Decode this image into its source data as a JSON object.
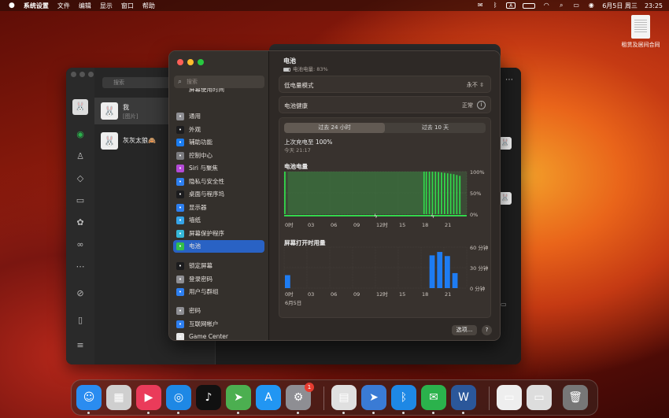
{
  "menubar": {
    "app_name": "系统设置",
    "menus": [
      "文件",
      "编辑",
      "显示",
      "窗口",
      "帮助"
    ],
    "input_indicator": "A",
    "date": "6月5日 周三",
    "time": "23:25"
  },
  "desktop": {
    "file_label": "租赁及居间合同"
  },
  "wechat": {
    "search_placeholder": "搜索",
    "chats": [
      {
        "name": "我",
        "preview": "[图片]"
      },
      {
        "name": "灰灰太狼🙈",
        "preview": ""
      }
    ]
  },
  "settings": {
    "search_placeholder": "搜索",
    "top_partial": "屏幕使用时间",
    "group1": [
      {
        "label": "通用",
        "icon": "gear-icon",
        "color": "#8e8e93"
      },
      {
        "label": "外观",
        "icon": "appearance-icon",
        "color": "#1c1c1e"
      },
      {
        "label": "辅助功能",
        "icon": "accessibility-icon",
        "color": "#1a7cf0"
      },
      {
        "label": "控制中心",
        "icon": "control-center-icon",
        "color": "#7c7c80"
      },
      {
        "label": "Siri 与聚焦",
        "icon": "siri-icon",
        "color": "#b44ad6"
      },
      {
        "label": "隐私与安全性",
        "icon": "hand-icon",
        "color": "#2d7ff0"
      }
    ],
    "group2": [
      {
        "label": "桌面与程序坞",
        "icon": "dock-icon",
        "color": "#1c1c1e"
      },
      {
        "label": "显示器",
        "icon": "display-icon",
        "color": "#2d7ff0"
      },
      {
        "label": "墙纸",
        "icon": "wallpaper-icon",
        "color": "#35a4e8"
      },
      {
        "label": "屏幕保护程序",
        "icon": "screensaver-icon",
        "color": "#35b8d8"
      },
      {
        "label": "电池",
        "icon": "battery-icon",
        "color": "#33c04a"
      }
    ],
    "group3": [
      {
        "label": "锁定屏幕",
        "icon": "lock-icon",
        "color": "#1c1c1e"
      },
      {
        "label": "登录密码",
        "icon": "password-icon",
        "color": "#8e8e93"
      },
      {
        "label": "用户与群组",
        "icon": "users-icon",
        "color": "#2d7ff0"
      }
    ],
    "group4": [
      {
        "label": "密码",
        "icon": "key-icon",
        "color": "#8e8e93"
      },
      {
        "label": "互联网帐户",
        "icon": "at-icon",
        "color": "#2d7ff0"
      },
      {
        "label": "Game Center",
        "icon": "game-center-icon",
        "color": "#e8e8e8"
      }
    ],
    "selected": "电池"
  },
  "battery": {
    "title": "电池",
    "subtitle": "电池电量: 83%",
    "low_power_label": "低电量模式",
    "low_power_value": "永不",
    "health_label": "电池健康",
    "health_value": "正常",
    "tab_24h": "过去 24 小时",
    "tab_10d": "过去 10 天",
    "last_charge": "上次充电至 100%",
    "last_charge_time": "今天 21:17",
    "options_label": "选项...",
    "help_label": "?"
  },
  "chart_data": [
    {
      "type": "area",
      "title": "电池电量",
      "x_ticks": [
        "0时",
        "03",
        "06",
        "09",
        "12时",
        "15",
        "18",
        "21"
      ],
      "y_ticks": [
        "100%",
        "50%",
        "0%"
      ],
      "ylim": [
        0,
        100
      ],
      "x": [
        0,
        0.5,
        18.3,
        18.6,
        19,
        19.4,
        19.8,
        20.2,
        20.6,
        21,
        21.4,
        21.8,
        22.2,
        22.6,
        23
      ],
      "values": [
        100,
        100,
        100,
        100,
        100,
        100,
        100,
        99,
        98,
        97,
        96,
        95,
        94,
        92,
        90
      ],
      "gap": [
        0.5,
        18.3
      ],
      "charging_at": [
        12,
        19.5
      ]
    },
    {
      "type": "bar",
      "title": "屏幕打开时用量",
      "x_ticks": [
        "0时",
        "03",
        "06",
        "09",
        "12时",
        "15",
        "18",
        "21"
      ],
      "y_ticks": [
        "60 分钟",
        "30 分钟",
        "0 分钟"
      ],
      "ylim": [
        0,
        60
      ],
      "date_label": "6月5日",
      "hours": [
        0,
        19,
        20,
        21,
        22
      ],
      "values": [
        19,
        48,
        53,
        47,
        22
      ]
    }
  ],
  "dock": [
    {
      "name": "finder",
      "glyph": "☺",
      "color": "#2a8cf0"
    },
    {
      "name": "launchpad",
      "glyph": "▦",
      "color": "#cfcfcf"
    },
    {
      "name": "video-app",
      "glyph": "▶",
      "color": "#ea3b5a"
    },
    {
      "name": "safari",
      "glyph": "◎",
      "color": "#1e88e5"
    },
    {
      "name": "tiktok",
      "glyph": "♪",
      "color": "#111111"
    },
    {
      "name": "maps",
      "glyph": "➤",
      "color": "#4caf50"
    },
    {
      "name": "app-store",
      "glyph": "A",
      "color": "#2196f3"
    },
    {
      "name": "system-settings",
      "glyph": "⚙",
      "color": "#8e8e93",
      "badge": "1"
    },
    {
      "name": "print-center",
      "glyph": "▤",
      "color": "#e0e0e0"
    },
    {
      "name": "cloud-drive",
      "glyph": "➤",
      "color": "#3a7bd5"
    },
    {
      "name": "bluetooth",
      "glyph": "ᛒ",
      "color": "#1e88e5"
    },
    {
      "name": "wechat",
      "glyph": "✉",
      "color": "#2bb24c"
    },
    {
      "name": "word",
      "glyph": "W",
      "color": "#2b579a"
    },
    {
      "name": "preview-docs",
      "glyph": "▭",
      "color": "#eeeeee"
    },
    {
      "name": "screenshots",
      "glyph": "▭",
      "color": "#dddddd"
    },
    {
      "name": "trash",
      "glyph": "🗑",
      "color": "#777777"
    }
  ]
}
